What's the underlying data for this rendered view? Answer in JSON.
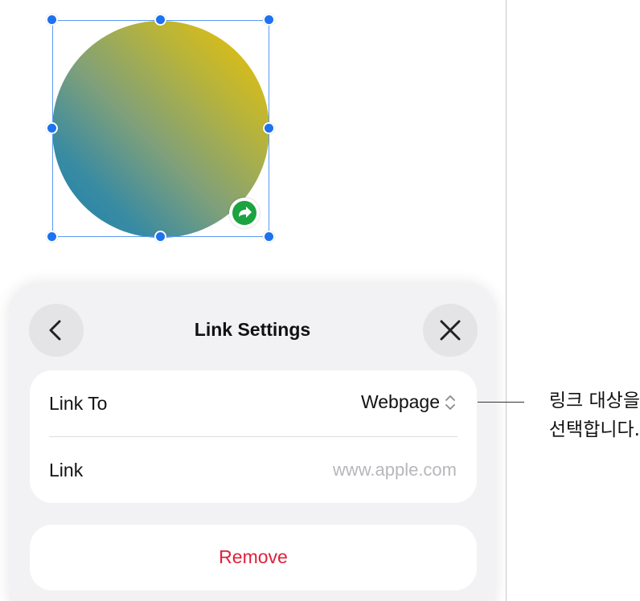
{
  "sheet": {
    "title": "Link Settings",
    "back_icon": "chevron-left-icon",
    "close_icon": "close-icon"
  },
  "link_settings": {
    "link_to_label": "Link To",
    "link_to_value": "Webpage",
    "link_to_icon": "up-down-chevron-icon",
    "link_label": "Link",
    "link_placeholder": "www.apple.com",
    "remove_label": "Remove"
  },
  "shape": {
    "badge_icon": "link-arrow-icon",
    "gradient_colors": [
      "#f2c200",
      "#1a82ad"
    ],
    "badge_color": "#1aa340",
    "handle_color": "#1d72f0"
  },
  "callout": {
    "line1": "링크 대상을",
    "line2": "선택합니다."
  },
  "colors": {
    "remove_text": "#e0203b",
    "placeholder_text": "#b7b7bc",
    "sheet_bg": "#f2f2f4"
  }
}
